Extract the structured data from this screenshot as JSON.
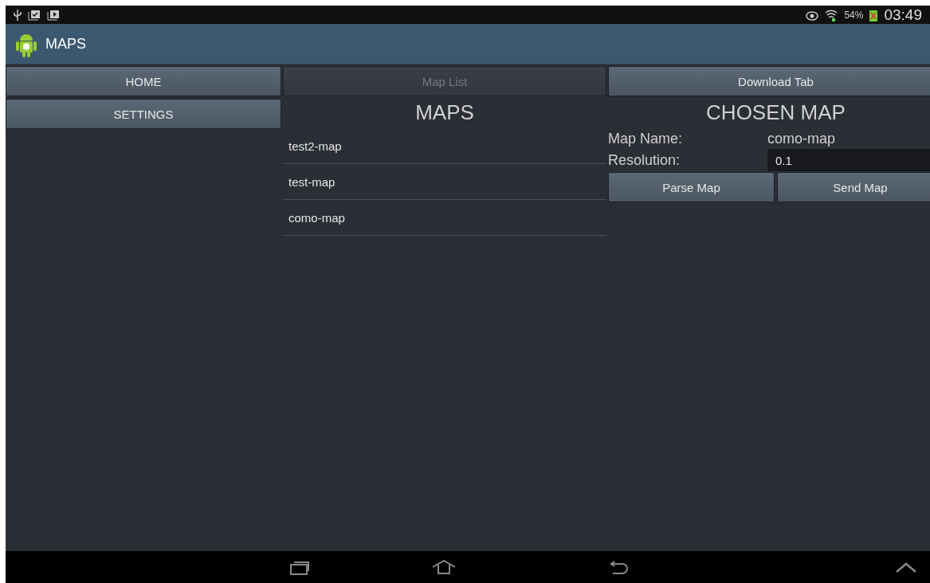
{
  "status_bar": {
    "battery_percent": "54%",
    "time": "03:49"
  },
  "action_bar": {
    "title": "MAPS"
  },
  "side_menu": [
    {
      "label": "HOME"
    },
    {
      "label": "SETTINGS"
    }
  ],
  "tabs": [
    {
      "label": "Map List",
      "selected": true
    },
    {
      "label": "Download Tab",
      "selected": false
    }
  ],
  "maps_panel": {
    "heading": "MAPS",
    "items": [
      {
        "name": "test2-map"
      },
      {
        "name": "test-map"
      },
      {
        "name": "como-map"
      }
    ]
  },
  "chosen_panel": {
    "heading": "CHOSEN MAP",
    "name_label": "Map Name:",
    "name_value": "como-map",
    "resolution_label": "Resolution:",
    "resolution_value": "0.1",
    "buttons": [
      "Parse Map",
      "Send Map"
    ]
  }
}
